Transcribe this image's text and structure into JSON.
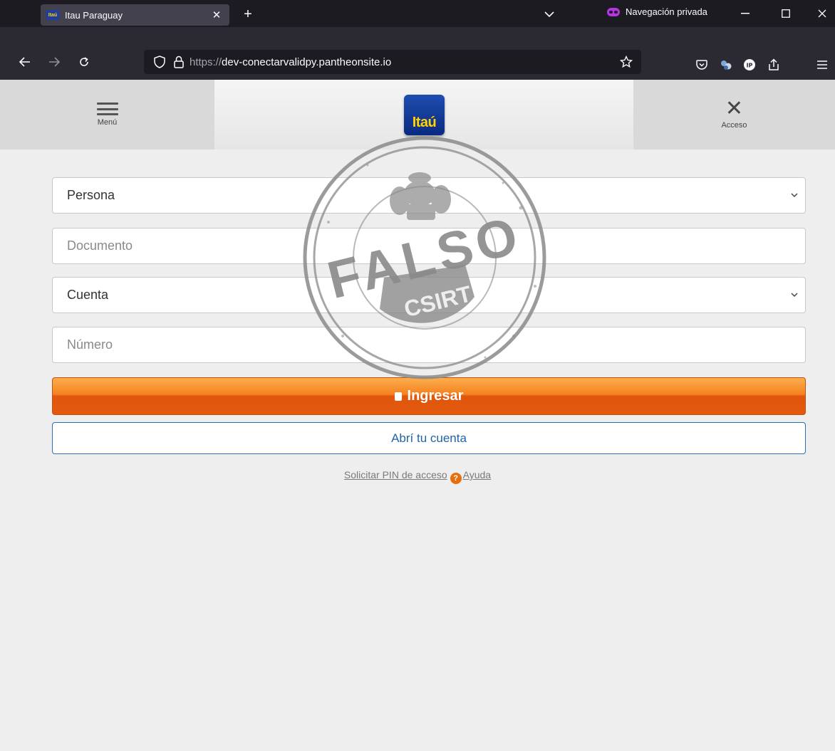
{
  "browser": {
    "tab_title": "Itau Paraguay",
    "tab_favicon_text": "Itaú",
    "private_label": "Navegación privada",
    "url_protocol": "https://",
    "url_host": "dev-conectarvalidpy.pantheonsite.io",
    "private_color": "#b833e1"
  },
  "header": {
    "menu_label": "Menú",
    "logo_text": "Itaú",
    "access_label": "Acceso"
  },
  "form": {
    "person_select": "Persona",
    "document_placeholder": "Documento",
    "account_select": "Cuenta",
    "number_placeholder": "Número",
    "login_button": "Ingresar",
    "open_account_button": "Abrí tu cuenta",
    "request_pin_link": "Solicitar PIN de acceso",
    "help_link": "Ayuda"
  },
  "stamp": {
    "main": "FALSO",
    "sub": "CSIRT"
  },
  "colors": {
    "orange": "#f58220",
    "itau_blue": "#1f4db0",
    "itau_yellow": "#ffd200",
    "link_blue": "#1f63aa"
  }
}
